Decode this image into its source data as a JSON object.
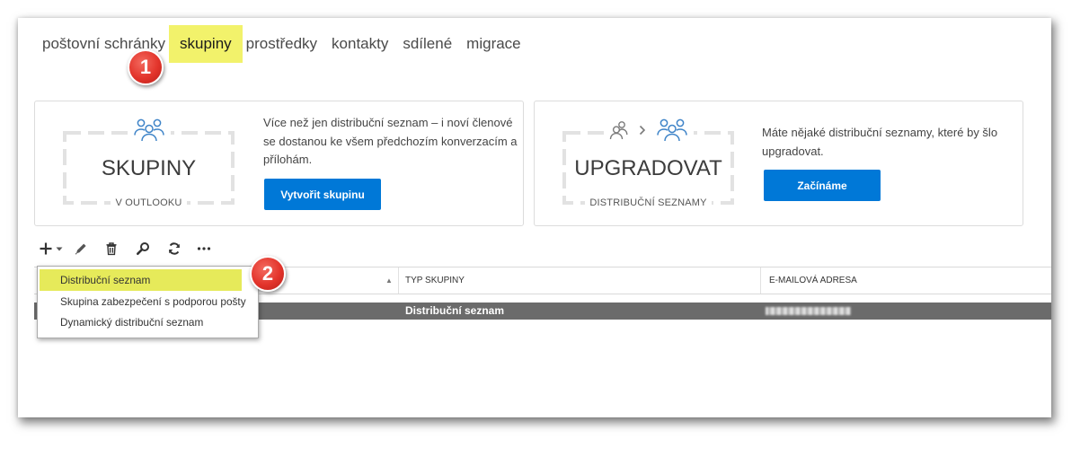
{
  "theme": {
    "accent": "#0078d7",
    "marker": "#f2f26b",
    "marker-menu": "#e6ea5a",
    "callout": "#e3342b",
    "selected-row": "#6b6b6b",
    "icon-blue": "#3f84c8"
  },
  "nav": {
    "tabs": [
      {
        "label": "poštovní schránky",
        "active": false
      },
      {
        "label": "skupiny",
        "active": true
      },
      {
        "label": "prostředky",
        "active": false
      },
      {
        "label": "kontakty",
        "active": false
      },
      {
        "label": "sdílené",
        "active": false
      },
      {
        "label": "migrace",
        "active": false
      }
    ]
  },
  "annotations": {
    "callouts": [
      "1",
      "2"
    ]
  },
  "cards": {
    "groups": {
      "icon": "people-group-icon",
      "title": "SKUPINY",
      "subtitle": "V OUTLOOKU",
      "description_lines": [
        "Více než jen distribuční seznam – i noví členové",
        "se dostanou ke všem předchozím konverzacím a",
        "přílohám."
      ],
      "button_label": "Vytvořit skupinu"
    },
    "upgrade": {
      "icons": [
        "people-pair-icon",
        "chevron-right-icon",
        "people-group-icon"
      ],
      "title": "UPGRADOVAT",
      "subtitle": "DISTRIBUČNÍ SEZNAMY",
      "description_lines": [
        "Máte nějaké distribuční seznamy, které by šlo",
        "upgradovat."
      ],
      "button_label": "Začínáme"
    }
  },
  "toolbar": {
    "buttons": [
      {
        "icon": "add-icon",
        "dropdown": true
      },
      {
        "icon": "edit-icon"
      },
      {
        "icon": "delete-icon"
      },
      {
        "icon": "search-icon"
      },
      {
        "icon": "refresh-icon"
      },
      {
        "icon": "more-icon"
      }
    ]
  },
  "new_menu": {
    "open": true,
    "items": [
      {
        "label": "Distribuční seznam",
        "marked": true
      },
      {
        "label": "Skupina zabezpečení s podporou pošty",
        "marked": false
      },
      {
        "label": "Dynamický distribuční seznam",
        "marked": false
      }
    ]
  },
  "table": {
    "columns": [
      {
        "sort_indicator": "▲"
      },
      {
        "label": "TYP SKUPINY"
      },
      {
        "label": "E-MAILOVÁ ADRESA"
      }
    ],
    "rows": [
      {
        "type": "Distribuční seznam",
        "selected": true
      }
    ]
  }
}
